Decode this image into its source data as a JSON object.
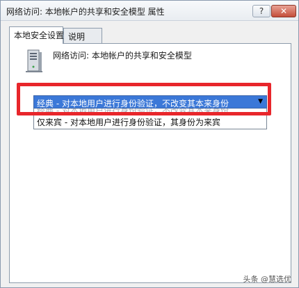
{
  "window": {
    "title": "网络访问: 本地帐户的共享和安全模型 属性",
    "help_button": "?",
    "close_button": "✕"
  },
  "tabs": [
    {
      "label": "本地安全设置",
      "active": true
    },
    {
      "label": "说明",
      "active": false
    }
  ],
  "policy": {
    "icon": "server-icon",
    "name": "网络访问: 本地帐户的共享和安全模型"
  },
  "dropdown": {
    "selected": "经典 - 对本地用户进行身份验证，不改变其本来身份",
    "options": [
      "经典 - 对本地用户进行身份验证，不改变其本来身份",
      "仅来宾 - 对本地用户进行身份验证，其身份为来宾"
    ]
  },
  "colors": {
    "highlight": "#3b78d8",
    "annotation_box": "#e8262b"
  },
  "watermark": "头条 @慧选优"
}
